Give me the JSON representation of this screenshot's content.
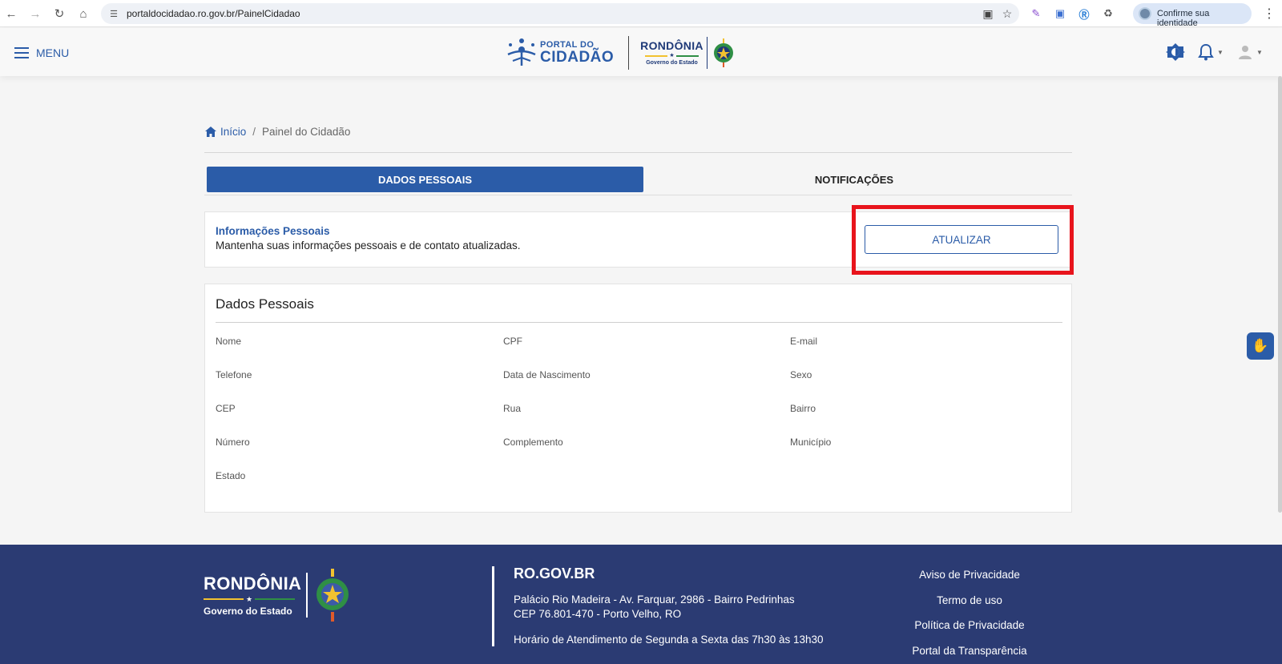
{
  "browser": {
    "url": "portaldocidadao.ro.gov.br/PainelCidadao",
    "identity_label": "Confirme sua identidade",
    "icons": [
      "back-icon",
      "forward-icon",
      "reload-icon",
      "home-icon",
      "site-info-icon",
      "install-app-icon",
      "bookmark-star-icon",
      "pen-extension-icon",
      "translate-extension-icon",
      "r-extension-icon",
      "extensions-puzzle-icon",
      "more-kebab-icon"
    ]
  },
  "header": {
    "menu_label": "MENU",
    "logo": {
      "portal_small": "PORTAL DO",
      "portal_big": "CIDADÃO",
      "state_big": "RONDÔNIA",
      "state_small": "Governo do Estado"
    },
    "icons": [
      "contrast-icon",
      "notification-bell-icon",
      "user-avatar-icon"
    ]
  },
  "breadcrumb": {
    "home_label": "Início",
    "separator": "/",
    "current": "Painel do Cidadão"
  },
  "tabs": [
    {
      "label": "DADOS PESSOAIS",
      "active": true
    },
    {
      "label": "NOTIFICAÇÕES",
      "active": false
    }
  ],
  "info_card": {
    "title": "Informações Pessoais",
    "description": "Mantenha suas informações pessoais e de contato atualizadas.",
    "button_label": "ATUALIZAR"
  },
  "personal_data": {
    "title": "Dados Pessoais",
    "fields": [
      "Nome",
      "CPF",
      "E-mail",
      "Telefone",
      "Data de Nascimento",
      "Sexo",
      "CEP",
      "Rua",
      "Bairro",
      "Número",
      "Complemento",
      "Município",
      "Estado"
    ]
  },
  "footer": {
    "logo": {
      "state_big": "RONDÔNIA",
      "state_small": "Governo do Estado"
    },
    "brand": "RO.GOV.BR",
    "address_line1": "Palácio Rio Madeira - Av. Farquar, 2986 - Bairro Pedrinhas",
    "address_line2": "CEP 76.801-470 - Porto Velho, RO",
    "hours": "Horário de Atendimento de Segunda a Sexta das 7h30 às 13h30",
    "links": [
      "Aviso de Privacidade",
      "Termo de uso",
      "Política de Privacidade",
      "Portal da Transparência"
    ]
  },
  "colors": {
    "primary": "#2b5ca8",
    "footer_bg": "#2b3b73",
    "highlight": "#e8141c",
    "star": "★"
  }
}
